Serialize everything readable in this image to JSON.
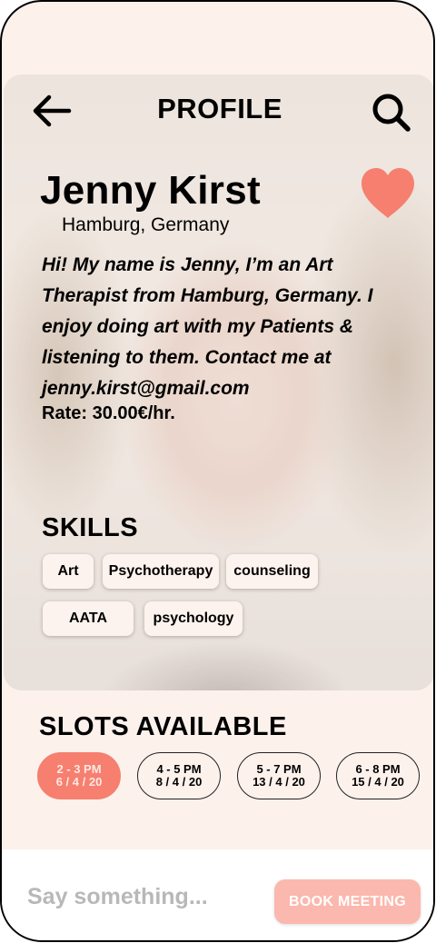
{
  "colors": {
    "background": "#fdf1ec",
    "accent": "#f67f6f",
    "heart": "#f67f6f",
    "book_button": "#fbb8ae",
    "placeholder": "#b8b8b8"
  },
  "header": {
    "back_icon": "arrow-left-icon",
    "title": "PROFILE",
    "search_icon": "search-icon"
  },
  "profile": {
    "name": "Jenny Kirst",
    "location": "Hamburg, Germany",
    "favorite_icon": "heart-icon",
    "favorited": true,
    "bio_lines": [
      "Hi! My name is Jenny, I’m an Art",
      "Therapist from Hamburg, Germany. I",
      "enjoy doing art with my Patients &",
      "listening to them. Contact me at",
      "jenny.kirst@gmail.com"
    ],
    "rate": "Rate: 30.00€/hr."
  },
  "skills": {
    "heading": "SKILLS",
    "items": [
      "Art",
      "Psychotherapy",
      "counseling",
      "AATA",
      "psychology"
    ]
  },
  "slots": {
    "heading": "SLOTS AVAILABLE",
    "items": [
      {
        "time": "2 - 3 PM",
        "date": "6 / 4 / 20",
        "selected": true
      },
      {
        "time": "4 - 5 PM",
        "date": "8 / 4 / 20",
        "selected": false
      },
      {
        "time": "5 - 7 PM",
        "date": "13 / 4 / 20",
        "selected": false
      },
      {
        "time": "6 - 8 PM",
        "date": "15 / 4 / 20",
        "selected": false
      }
    ]
  },
  "footer": {
    "message_placeholder": "Say something...",
    "book_label": "BOOK MEETING"
  }
}
